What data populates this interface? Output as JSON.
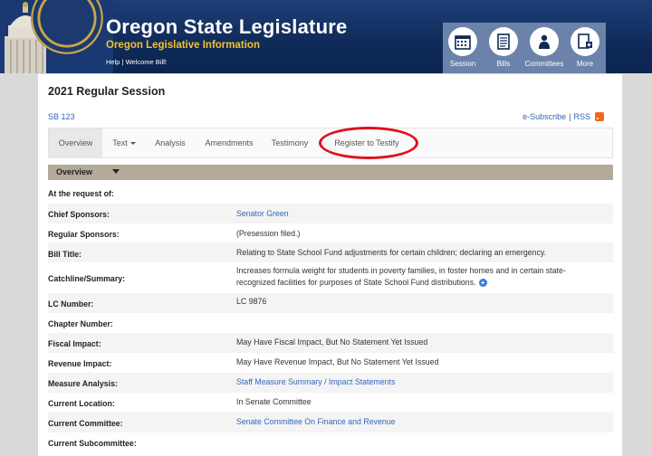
{
  "header": {
    "title": "Oregon State Legislature",
    "subtitle": "Oregon Legislative Information",
    "help": "Help",
    "separator": "|",
    "welcome": "Welcome Bill!",
    "nav": [
      {
        "label": "Session",
        "icon": "calendar-icon"
      },
      {
        "label": "Bills",
        "icon": "document-icon"
      },
      {
        "label": "Committees",
        "icon": "people-icon"
      },
      {
        "label": "More",
        "icon": "plus-document-icon"
      }
    ]
  },
  "main": {
    "session_title": "2021 Regular Session",
    "bill_number": "SB 123",
    "subscribe": "e-Subscribe",
    "rss": "RSS",
    "tabs": [
      "Overview",
      "Text",
      "Analysis",
      "Amendments",
      "Testimony",
      "Register to Testify"
    ],
    "active_tab": "Overview",
    "section_title": "Overview",
    "rows": [
      {
        "label": "At the request of:",
        "value": ""
      },
      {
        "label": "Chief Sponsors:",
        "value": "Senator Green",
        "link": true
      },
      {
        "label": "Regular Sponsors:",
        "value": "(Presession filed.)"
      },
      {
        "label": "Bill Title:",
        "value": "Relating to State School Fund adjustments for certain children; declaring an emergency."
      },
      {
        "label": "Catchline/Summary:",
        "value": "Increases formula weight for students in poverty families, in foster homes and in certain state-recognized facilities for purposes of State School Fund distributions."
      },
      {
        "label": "LC Number:",
        "value": "LC 9876"
      },
      {
        "label": "Chapter Number:",
        "value": ""
      },
      {
        "label": "Fiscal Impact:",
        "value": "May Have Fiscal Impact, But No Statement Yet Issued"
      },
      {
        "label": "Revenue Impact:",
        "value": "May Have Revenue Impact, But No Statement Yet Issued"
      },
      {
        "label": "Measure Analysis:",
        "value": "Staff Measure Summary / Impact Statements",
        "link": true
      },
      {
        "label": "Current Location:",
        "value": "In Senate Committee"
      },
      {
        "label": "Current Committee:",
        "value": "Senate Committee On Finance and Revenue",
        "link": true
      },
      {
        "label": "Current Subcommittee:",
        "value": ""
      }
    ]
  },
  "colors": {
    "header_bg": "#0f2a58",
    "subtitle": "#f2c230",
    "link": "#3366bb",
    "annotation_circle": "#e0111a",
    "section_bar": "#b3aa99"
  }
}
